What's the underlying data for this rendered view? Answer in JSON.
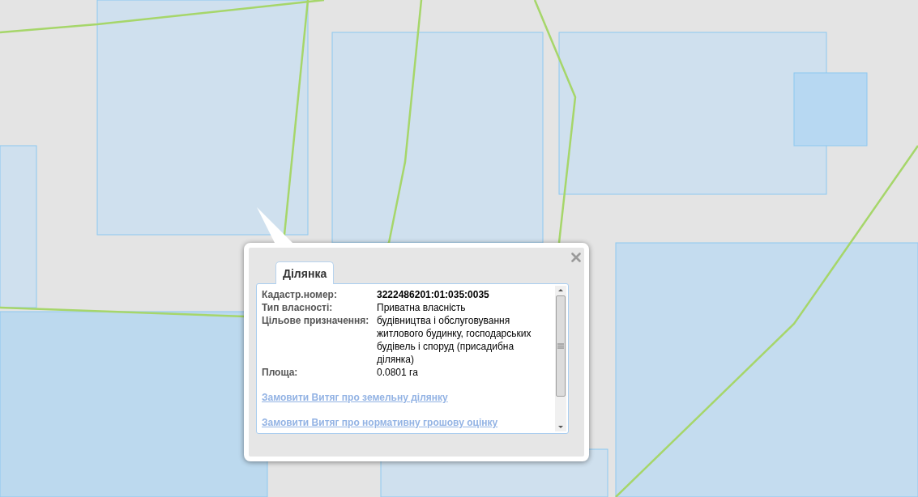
{
  "popup": {
    "tabs": [
      {
        "label": "Ділянка",
        "selected": true
      }
    ],
    "fields": [
      {
        "label": "Кадастр.номер:",
        "value": "3222486201:01:035:0035",
        "kind": "emphasis"
      },
      {
        "label": "Тип власності:",
        "value": "Приватна власність",
        "kind": "plain"
      },
      {
        "label": "Цільове призначення:",
        "value": "будівництва і обслуговування житлового будинку, господарських будівель і споруд (присадибна ділянка)",
        "kind": "plain"
      },
      {
        "label": "Площа:",
        "value": "0.0801 га",
        "kind": "plain"
      }
    ],
    "links": [
      "Замовити Витяг про земельну ділянку",
      "Замовити Витяг про нормативну грошову оцінку"
    ]
  }
}
